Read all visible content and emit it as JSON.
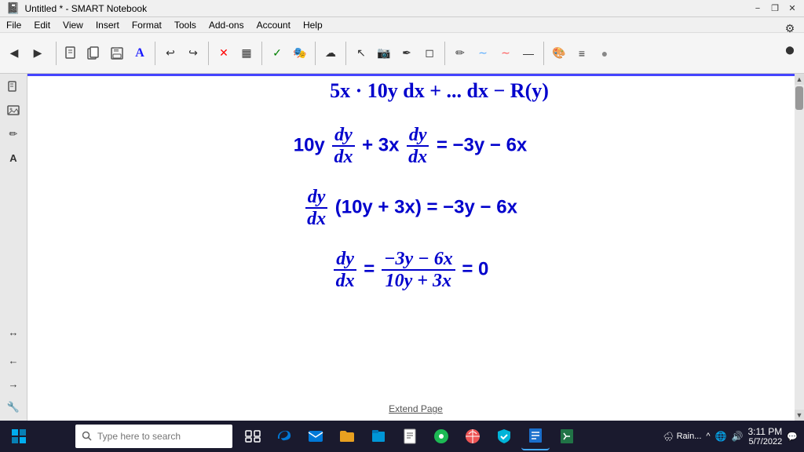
{
  "titlebar": {
    "title": "Untitled * - SMART Notebook",
    "min_label": "−",
    "max_label": "❐",
    "close_label": "✕"
  },
  "menubar": {
    "items": [
      "File",
      "Edit",
      "View",
      "Insert",
      "Format",
      "Tools",
      "Add-ons",
      "Account",
      "Help"
    ]
  },
  "toolbar": {
    "nav_back": "◀",
    "nav_forward": "▶",
    "settings_icon": "⚙",
    "tools": [
      "↩",
      "↪",
      "📄",
      "📋",
      "💾",
      "🖊",
      "✕",
      "▦",
      "✓",
      "🎭",
      "☁",
      "↔",
      "⊕"
    ]
  },
  "sidebar": {
    "tools": [
      "📄",
      "🖼",
      "✏",
      "A",
      "🔲"
    ]
  },
  "canvas": {
    "extend_page_label": "Extend Page",
    "top_partial_equation": "5x·10y dx + ... dx − R(y)",
    "equations": [
      "10y dy/dx + 3x dy/dx = −3y − 6x",
      "dy/dx (10y + 3x) = −3y − 6x",
      "dy/dx = (−3y − 6x) / (10y + 3x) = 0"
    ]
  },
  "taskbar": {
    "search_placeholder": "Type here to search",
    "clock_time": "3:11 PM",
    "clock_date": "5/7/2022",
    "apps": [
      "⊞",
      "🔍",
      "🌐",
      "📧",
      "📁",
      "🗂",
      "🎵",
      "🌐",
      "🛡",
      "🐦",
      "📊",
      "🎮"
    ]
  }
}
